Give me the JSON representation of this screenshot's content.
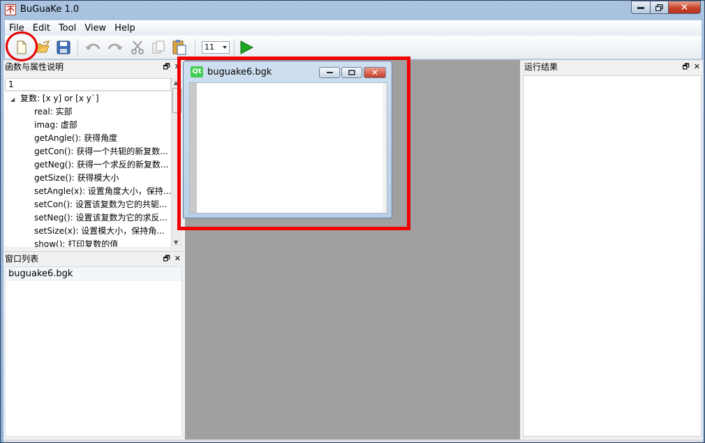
{
  "window": {
    "title": "BuGuaKe 1.0",
    "app_icon_glyph": "不"
  },
  "menubar": {
    "items": [
      "File",
      "Edit",
      "Tool",
      "View",
      "Help"
    ]
  },
  "toolbar": {
    "icons": [
      "new-file-icon",
      "open-folder-icon",
      "save-icon",
      "undo-icon",
      "redo-icon",
      "cut-icon",
      "copy-icon",
      "paste-icon",
      "run-icon"
    ],
    "font_size": "11"
  },
  "func_dock": {
    "title": "函数与属性说明",
    "search_value": "1",
    "tree": {
      "parent": "复数: [x y] or [x y`]",
      "children": [
        "real: 实部",
        "imag: 虚部",
        "getAngle(): 获得角度",
        "getCon(): 获得一个共轭的新复数...",
        "getNeg(): 获得一个求反的新复数...",
        "getSize(): 获得模大小",
        "setAngle(x): 设置角度大小，保持...",
        "setCon(): 设置该复数为它的共轭...",
        "setNeg(): 设置该复数为它的求反...",
        "setSize(x): 设置模大小，保持角...",
        "show(): 打印复数的值"
      ]
    }
  },
  "window_dock": {
    "title": "窗口列表",
    "items": [
      "buguake6.bgk"
    ]
  },
  "result_dock": {
    "title": "运行结果"
  },
  "child_window": {
    "title": "buguake6.bgk",
    "icon_text": "Qt"
  },
  "colors": {
    "annotation": "#ff0000",
    "mdi_background": "#a0a0a0",
    "run": "#1fa51f"
  }
}
